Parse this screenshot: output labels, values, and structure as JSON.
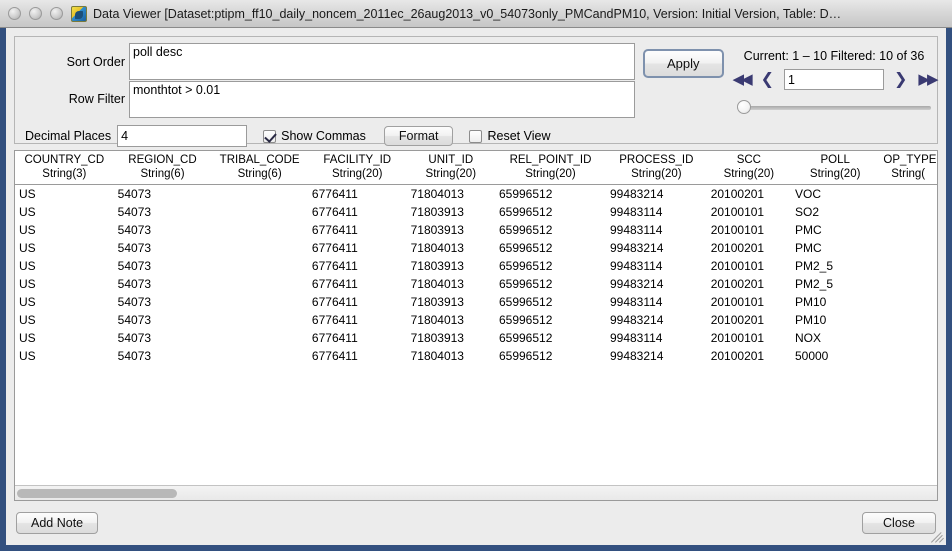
{
  "window": {
    "title": "Data Viewer [Dataset:ptipm_ff10_daily_noncem_2011ec_26aug2013_v0_54073only_PMCandPM10, Version: Initial Version, Table: D…",
    "app_icon": "data-viewer-icon"
  },
  "form": {
    "sort_order_label": "Sort Order",
    "sort_order_value": "poll desc",
    "sort_order_placeholder": "",
    "row_filter_label": "Row Filter",
    "row_filter_value": "monthtot > 0.01",
    "row_filter_placeholder": "",
    "decimal_places_label": "Decimal Places",
    "decimal_places_value": "4",
    "show_commas_label": "Show Commas",
    "show_commas_checked": true,
    "format_label": "Format",
    "reset_view_label": "Reset View",
    "reset_view_checked": false
  },
  "nav": {
    "apply_label": "Apply",
    "current_label": "Current: 1 – 10 Filtered: 10 of 36",
    "first_icon": "first-page-icon",
    "prev_icon": "previous-page-icon",
    "next_icon": "next-page-icon",
    "last_icon": "last-page-icon",
    "first_glyph": "◀◀",
    "prev_glyph": "❮",
    "next_glyph": "❯",
    "last_glyph": "▶▶",
    "page_value": "1",
    "slider_value": 0
  },
  "table": {
    "columns": [
      {
        "name": "COUNTRY_CD",
        "type": "String(3)",
        "align": "txt"
      },
      {
        "name": "REGION_CD",
        "type": "String(6)",
        "align": "txt"
      },
      {
        "name": "TRIBAL_CODE",
        "type": "String(6)",
        "align": "txt"
      },
      {
        "name": "FACILITY_ID",
        "type": "String(20)",
        "align": "txt"
      },
      {
        "name": "UNIT_ID",
        "type": "String(20)",
        "align": "txt"
      },
      {
        "name": "REL_POINT_ID",
        "type": "String(20)",
        "align": "txt"
      },
      {
        "name": "PROCESS_ID",
        "type": "String(20)",
        "align": "txt"
      },
      {
        "name": "SCC",
        "type": "String(20)",
        "align": "txt"
      },
      {
        "name": "POLL",
        "type": "String(20)",
        "align": "txt"
      },
      {
        "name": "OP_TYPE",
        "type": "String(",
        "align": "txt"
      }
    ],
    "rows": [
      [
        "US",
        "54073",
        "",
        "6776411",
        "71804013",
        "65996512",
        "99483214",
        "20100201",
        "VOC",
        ""
      ],
      [
        "US",
        "54073",
        "",
        "6776411",
        "71803913",
        "65996512",
        "99483114",
        "20100101",
        "SO2",
        ""
      ],
      [
        "US",
        "54073",
        "",
        "6776411",
        "71803913",
        "65996512",
        "99483114",
        "20100101",
        "PMC",
        ""
      ],
      [
        "US",
        "54073",
        "",
        "6776411",
        "71804013",
        "65996512",
        "99483214",
        "20100201",
        "PMC",
        ""
      ],
      [
        "US",
        "54073",
        "",
        "6776411",
        "71803913",
        "65996512",
        "99483114",
        "20100101",
        "PM2_5",
        ""
      ],
      [
        "US",
        "54073",
        "",
        "6776411",
        "71804013",
        "65996512",
        "99483214",
        "20100201",
        "PM2_5",
        ""
      ],
      [
        "US",
        "54073",
        "",
        "6776411",
        "71803913",
        "65996512",
        "99483114",
        "20100101",
        "PM10",
        ""
      ],
      [
        "US",
        "54073",
        "",
        "6776411",
        "71804013",
        "65996512",
        "99483214",
        "20100201",
        "PM10",
        ""
      ],
      [
        "US",
        "54073",
        "",
        "6776411",
        "71803913",
        "65996512",
        "99483114",
        "20100101",
        "NOX",
        ""
      ],
      [
        "US",
        "54073",
        "",
        "6776411",
        "71804013",
        "65996512",
        "99483214",
        "20100201",
        "50000",
        ""
      ]
    ]
  },
  "footer": {
    "add_note_label": "Add Note",
    "close_label": "Close"
  },
  "colors": {
    "window_border": "#33507f",
    "panel_bg": "#ececec",
    "nav_arrow": "#3a3a72",
    "scroll_thumb": "#b8b8b8"
  }
}
